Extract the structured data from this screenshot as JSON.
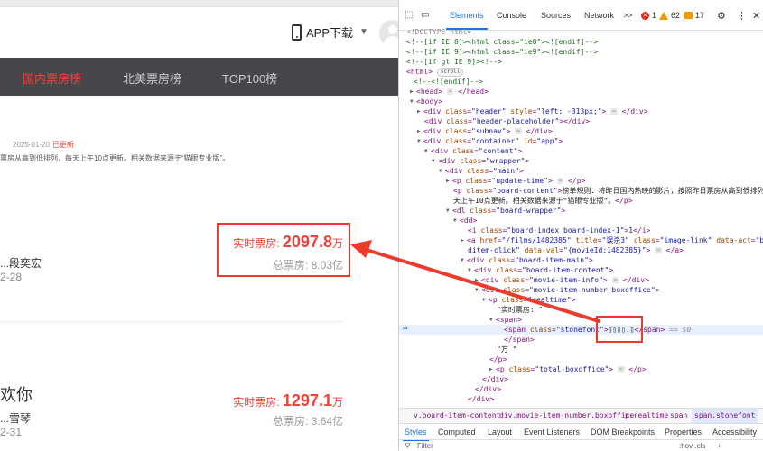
{
  "page": {
    "app_download": "APP下载",
    "nav": [
      "国内票房榜",
      "北美票房榜",
      "TOP100榜"
    ],
    "update_date": "2025-01-20",
    "update_label": "已更新",
    "board_content": "票房从高到低排列，每天上午10点更新。相关数据来源于“猫眼专业版”。",
    "items": [
      {
        "name": "",
        "star": "...段奕宏",
        "date": "2-28",
        "realtime_label": "实时票房:",
        "realtime_value": "2097.8",
        "realtime_unit": "万",
        "total": "总票房: 8.03亿"
      },
      {
        "name": "欢你",
        "star": "...雪琴",
        "date": "2-31",
        "realtime_label": "实时票房:",
        "realtime_value": "1297.1",
        "realtime_unit": "万",
        "total": "总票房: 3.64亿"
      }
    ]
  },
  "devtools": {
    "tabs": [
      "Elements",
      "Console",
      "Sources",
      "Network"
    ],
    "more_tabs": ">>",
    "errors": "1",
    "warnings": "62",
    "infos": "17",
    "scroll_pill": "scroll",
    "ellipsis": "⋯",
    "dollar0": "== $0",
    "lines": {
      "doctype": "<!DOCTYPE html>",
      "ie8": "<!--[if IE 8]><html class=\"ie8\"><![endif]-->",
      "ie9": "<!--[if IE 9]><html class=\"ie9\"><![endif]-->",
      "gtie9": "<!--[if gt IE 9]><!-->",
      "endif": "<!--<![endif]-->",
      "update_text": "榜单规则：将昨日国内热映的影片，按照昨日票房从高到低排列，每",
      "update_text2": "天上午10点更新。相关数据来源于“猫眼专业版”。",
      "href": "/films/1482385",
      "title_val": "误杀3",
      "data_val": "{movieId:1482385}",
      "realtime_text": "\"实时票房: \"",
      "stonefont_text": "▯▯▯▯.▯",
      "wan_text": "\"万 \""
    },
    "crumbs": [
      "v.board-item-content",
      "div.movie-item-number.boxoffice",
      "p.realtime",
      "span",
      "span.stonefont"
    ],
    "bottom_tabs": [
      "Styles",
      "Computed",
      "Layout",
      "Event Listeners",
      "DOM Breakpoints",
      "Properties",
      "Accessibility"
    ],
    "filter_placeholder": "Filter",
    "filter_right": ":hov .cls"
  },
  "colors": {
    "accent_red": "#ef4238",
    "nav_bg": "#47464a",
    "devtools_blue": "#1a73e8"
  }
}
